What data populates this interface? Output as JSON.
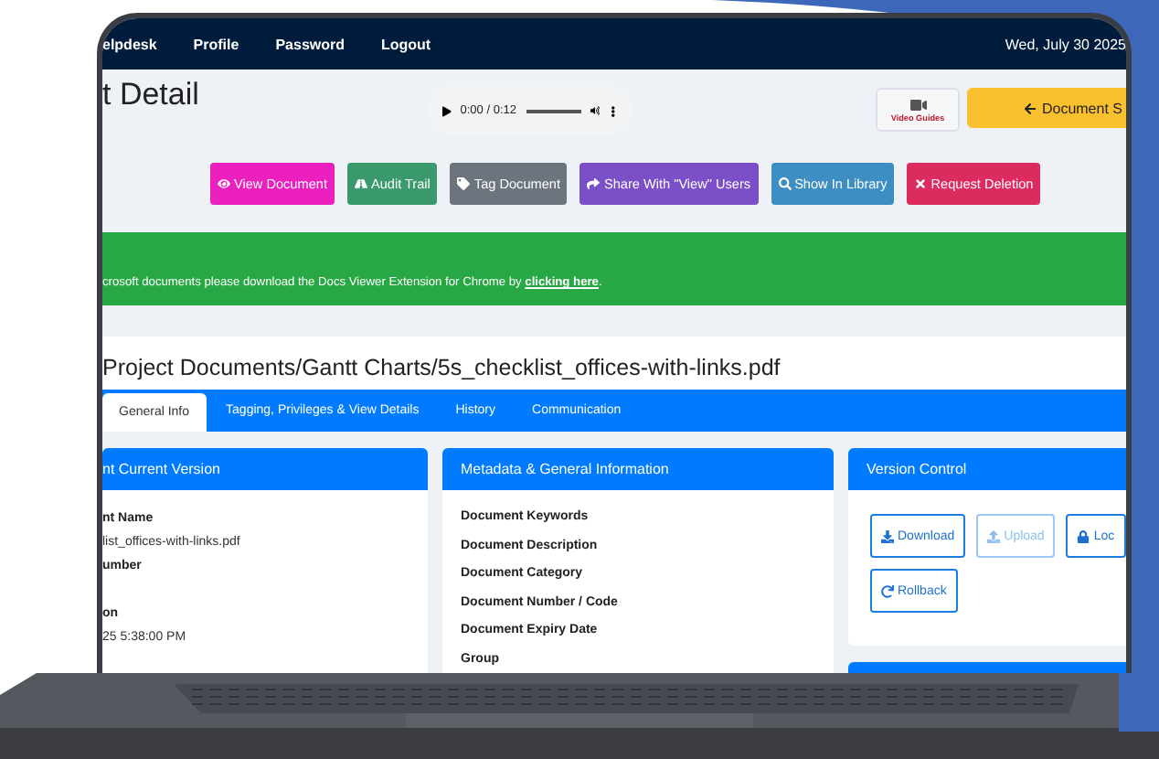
{
  "nav": {
    "links": [
      "elpdesk",
      "Profile",
      "Password",
      "Logout"
    ],
    "date": "Wed, July 30 2025"
  },
  "header": {
    "title": "t Detail",
    "audio": {
      "time": "0:00 / 0:12",
      "level": 0
    },
    "video_guides": "Video Guides",
    "back_button": "Document S"
  },
  "actions": [
    {
      "label": "View Document",
      "color": "#ec1fbf"
    },
    {
      "label": "Audit Trail",
      "color": "#3b9a6d"
    },
    {
      "label": "Tag Document",
      "color": "#6c757d"
    },
    {
      "label": "Share With \"View\" Users",
      "color": "#7a4fc8"
    },
    {
      "label": "Show In Library",
      "color": "#3d8fc3"
    },
    {
      "label": "Request Deletion",
      "color": "#dc2b5f"
    }
  ],
  "alert": {
    "text": "crosoft documents please download the Docs Viewer Extension for Chrome by ",
    "link": "clicking here",
    "after": "."
  },
  "path_title": "Project Documents/Gantt Charts/5s_checklist_offices-with-links.pdf",
  "tabs": [
    {
      "label": "General Info",
      "selected": true
    },
    {
      "label": "Tagging, Privileges & View Details",
      "selected": false
    },
    {
      "label": "History",
      "selected": false
    },
    {
      "label": "Communication",
      "selected": false
    }
  ],
  "current_version": {
    "title": "nt Current Version",
    "fields": [
      {
        "label": "nt Name",
        "value": "list_offices-with-links.pdf"
      },
      {
        "label": "umber"
      },
      {
        "label": "on",
        "value": "25 5:38:00 PM"
      }
    ]
  },
  "metadata": {
    "title": "Metadata & General Information",
    "fields": [
      "Document Keywords",
      "Document Description",
      "Document Category",
      "Document Number / Code",
      "Document Expiry Date",
      "Group"
    ]
  },
  "version_control": {
    "title": "Version Control",
    "buttons": [
      {
        "label": "Download",
        "disabled": false
      },
      {
        "label": "Upload",
        "disabled": true
      },
      {
        "label": "Loc",
        "disabled": false
      },
      {
        "label": "Rollback",
        "disabled": false
      }
    ]
  }
}
